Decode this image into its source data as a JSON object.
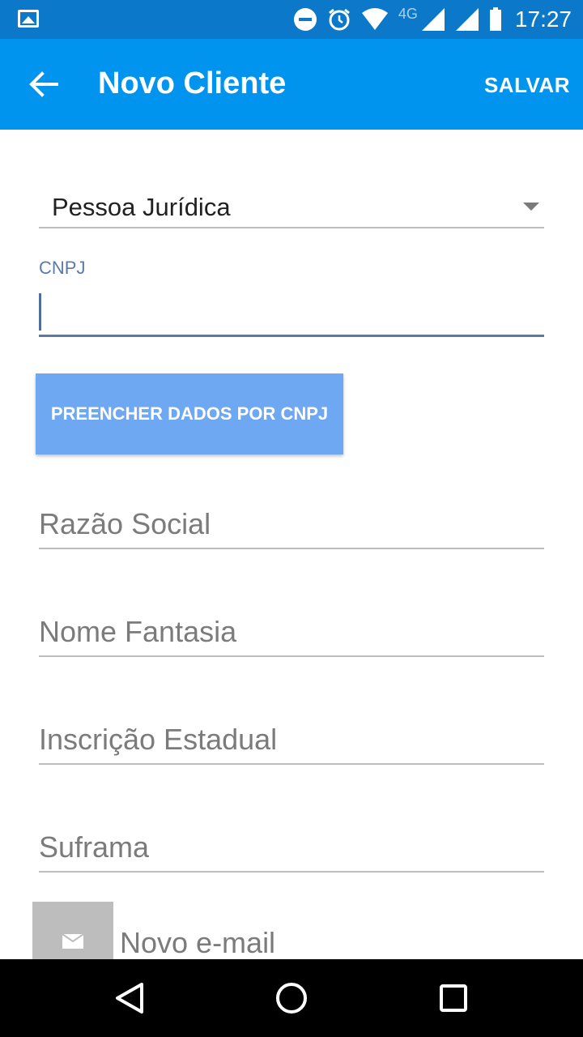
{
  "status_bar": {
    "network": "4G",
    "time": "17:27"
  },
  "app_bar": {
    "title": "Novo Cliente",
    "save_label": "SALVAR"
  },
  "form": {
    "person_type": "Pessoa Jurídica",
    "cnpj_label": "CNPJ",
    "cnpj_value": "",
    "fill_button_label": "PREENCHER DADOS POR CNPJ",
    "razao_social_placeholder": "Razão Social",
    "nome_fantasia_placeholder": "Nome Fantasia",
    "inscricao_estadual_placeholder": "Inscrição Estadual",
    "suframa_placeholder": "Suframa",
    "new_email_label": "Novo e-mail"
  },
  "colors": {
    "app_bar": "#0094ef",
    "status_bar": "#0b78c9",
    "accent": "#5a7aa8",
    "button": "#6fa8f2"
  }
}
